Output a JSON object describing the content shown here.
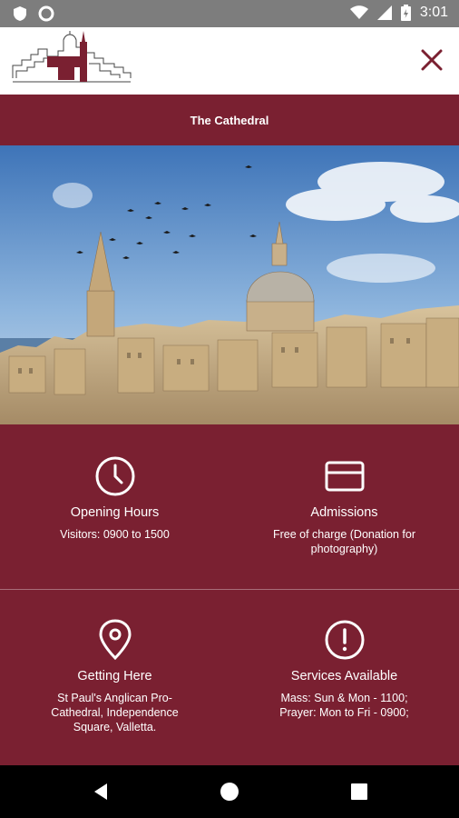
{
  "status_bar": {
    "time": "3:01",
    "icons": [
      "shield-icon",
      "circle-icon",
      "wifi-icon",
      "signal-icon",
      "battery-icon"
    ]
  },
  "header": {
    "logo": "cathedral-skyline-logo",
    "close_icon": "close-icon"
  },
  "title": "The Cathedral",
  "hero_image": "valletta-skyline-photo",
  "cards": [
    {
      "icon": "clock-icon",
      "title": "Opening Hours",
      "text": "Visitors: 0900 to 1500"
    },
    {
      "icon": "credit-card-icon",
      "title": "Admissions",
      "text": "Free of charge (Donation for photography)"
    },
    {
      "icon": "location-pin-icon",
      "title": "Getting Here",
      "text": "St Paul's Anglican Pro-Cathedral, Independence Square, Valletta."
    },
    {
      "icon": "exclamation-icon",
      "title": "Services Available",
      "text": "Mass: Sun & Mon - 1100; Prayer: Mon to Fri - 0900;"
    }
  ],
  "nav": [
    "back-icon",
    "home-icon",
    "recents-icon"
  ],
  "colors": {
    "brand": "#7a2031",
    "status_bar": "#7d7d7d",
    "header_bg": "#ffffff",
    "nav_bg": "#000000"
  }
}
